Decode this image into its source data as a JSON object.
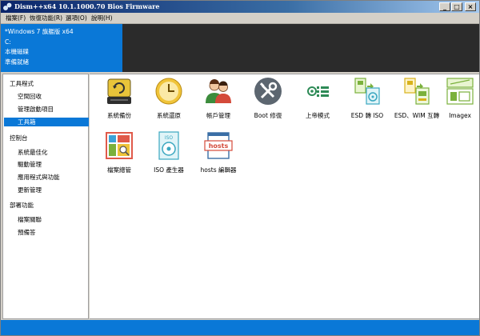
{
  "window": {
    "title": "Dism++x64 10.1.1000.70 Bios Firmware",
    "controls": {
      "minimize": "_",
      "maximize": "□",
      "close": "×"
    }
  },
  "menu": [
    "檔案(F)",
    "恢復功能(R)",
    "選項(O)",
    "說明(H)"
  ],
  "info": {
    "os": "*Windows 7 旗艦版 x64",
    "drive": "C:",
    "disk": "本機磁碟",
    "status": "準備就緒"
  },
  "sidebar": {
    "groups": [
      {
        "heading": "工具程式",
        "items": [
          "空間回收",
          "管理啟動項目",
          "工具箱"
        ]
      },
      {
        "heading": "控制台",
        "items": [
          "系統最佳化",
          "驅動管理",
          "應用程式與功能",
          "更新管理"
        ]
      },
      {
        "heading": "部署功能",
        "items": [
          "檔案關聯",
          "預備答"
        ]
      }
    ],
    "selected": "工具箱"
  },
  "tools": [
    {
      "label": "系統備份",
      "icon": "backup-drive-icon"
    },
    {
      "label": "系統還原",
      "icon": "restore-clock-icon"
    },
    {
      "label": "帳戶管理",
      "icon": "users-icon"
    },
    {
      "label": "Boot 修復",
      "icon": "wrench-screwdriver-icon"
    },
    {
      "label": "上帝模式",
      "icon": "god-mode-icon"
    },
    {
      "label": "ESD 轉 ISO",
      "icon": "esd-to-iso-icon"
    },
    {
      "label": "ESD、WIM 互轉",
      "icon": "esd-wim-convert-icon"
    },
    {
      "label": "Imagex",
      "icon": "imagex-icon"
    },
    {
      "label": "檔案總管",
      "icon": "file-explorer-icon"
    },
    {
      "label": "ISO 產生器",
      "icon": "iso-creator-icon"
    },
    {
      "label": "hosts 編輯器",
      "icon": "hosts-editor-icon"
    }
  ],
  "icon_text": {
    "iso": "ISO",
    "hosts": "hosts"
  },
  "colors": {
    "accent": "#0a78d7",
    "info_dark": "#2b2b2b",
    "status_bar": "#0a78d7"
  }
}
